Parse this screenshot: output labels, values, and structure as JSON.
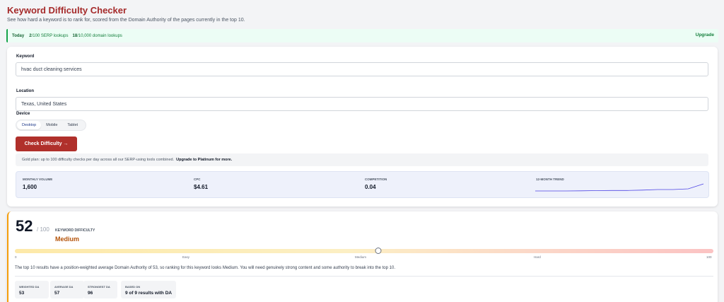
{
  "header": {
    "title": "Keyword Difficulty Checker",
    "subtitle": "See how hard a keyword is to rank for, scored from the Domain Authority of the pages currently in the top 10."
  },
  "usage": {
    "today_label": "Today",
    "serp_used": "2",
    "serp_text": "/100 SERP lookups",
    "domain_used": "18",
    "domain_text": "/10,000 domain lookups",
    "upgrade_label": "Upgrade"
  },
  "form": {
    "keyword_label": "Keyword",
    "keyword_value": "hvac duct cleaning services",
    "location_label": "Location",
    "location_value": "Texas, United States",
    "device_label": "Device",
    "devices": [
      "Desktop",
      "Mobile",
      "Tablet"
    ],
    "selected_device": "Desktop",
    "submit_label": "Check Difficulty →",
    "plan_note": "Gold plan: up to 100 difficulty checks per day across all our SERP-using tools combined.",
    "plan_note_cta": "Upgrade to Platinum for more."
  },
  "metrics": {
    "volume_label": "MONTHLY VOLUME",
    "volume_value": "1,600",
    "cpc_label": "CPC",
    "cpc_value": "$4.61",
    "competition_label": "COMPETITION",
    "competition_value": "0.04",
    "trend_label": "12-MONTH TREND",
    "trend_values": [
      1300,
      1300,
      1300,
      1310,
      1320,
      1330,
      1330,
      1350,
      1380,
      1380,
      1420,
      1700
    ]
  },
  "result": {
    "score": "52",
    "score_max": "/ 100",
    "score_label": "KEYWORD DIFFICULTY",
    "level": "Medium",
    "score_fraction": 0.52,
    "scale_ticks": [
      "0",
      "Easy",
      "Medium",
      "Hard",
      "100"
    ],
    "explanation": "The top 10 results have a position-weighted average Domain Authority of 53, so ranking for this keyword looks Medium. You will need genuinely strong content and some authority to break into the top 10.",
    "stats": [
      {
        "label": "WEIGHTED DA",
        "value": "53"
      },
      {
        "label": "AVERAGE DA",
        "value": "57"
      },
      {
        "label": "STRONGEST DA",
        "value": "96"
      },
      {
        "label": "BASED ON",
        "value": "9 of 9 results with DA"
      }
    ]
  },
  "colors": {
    "brand": "#a52a2a",
    "button": "#b0302b",
    "accent_green": "#16a34a",
    "medium": "#b45309",
    "trend_line": "#4f46e5"
  }
}
